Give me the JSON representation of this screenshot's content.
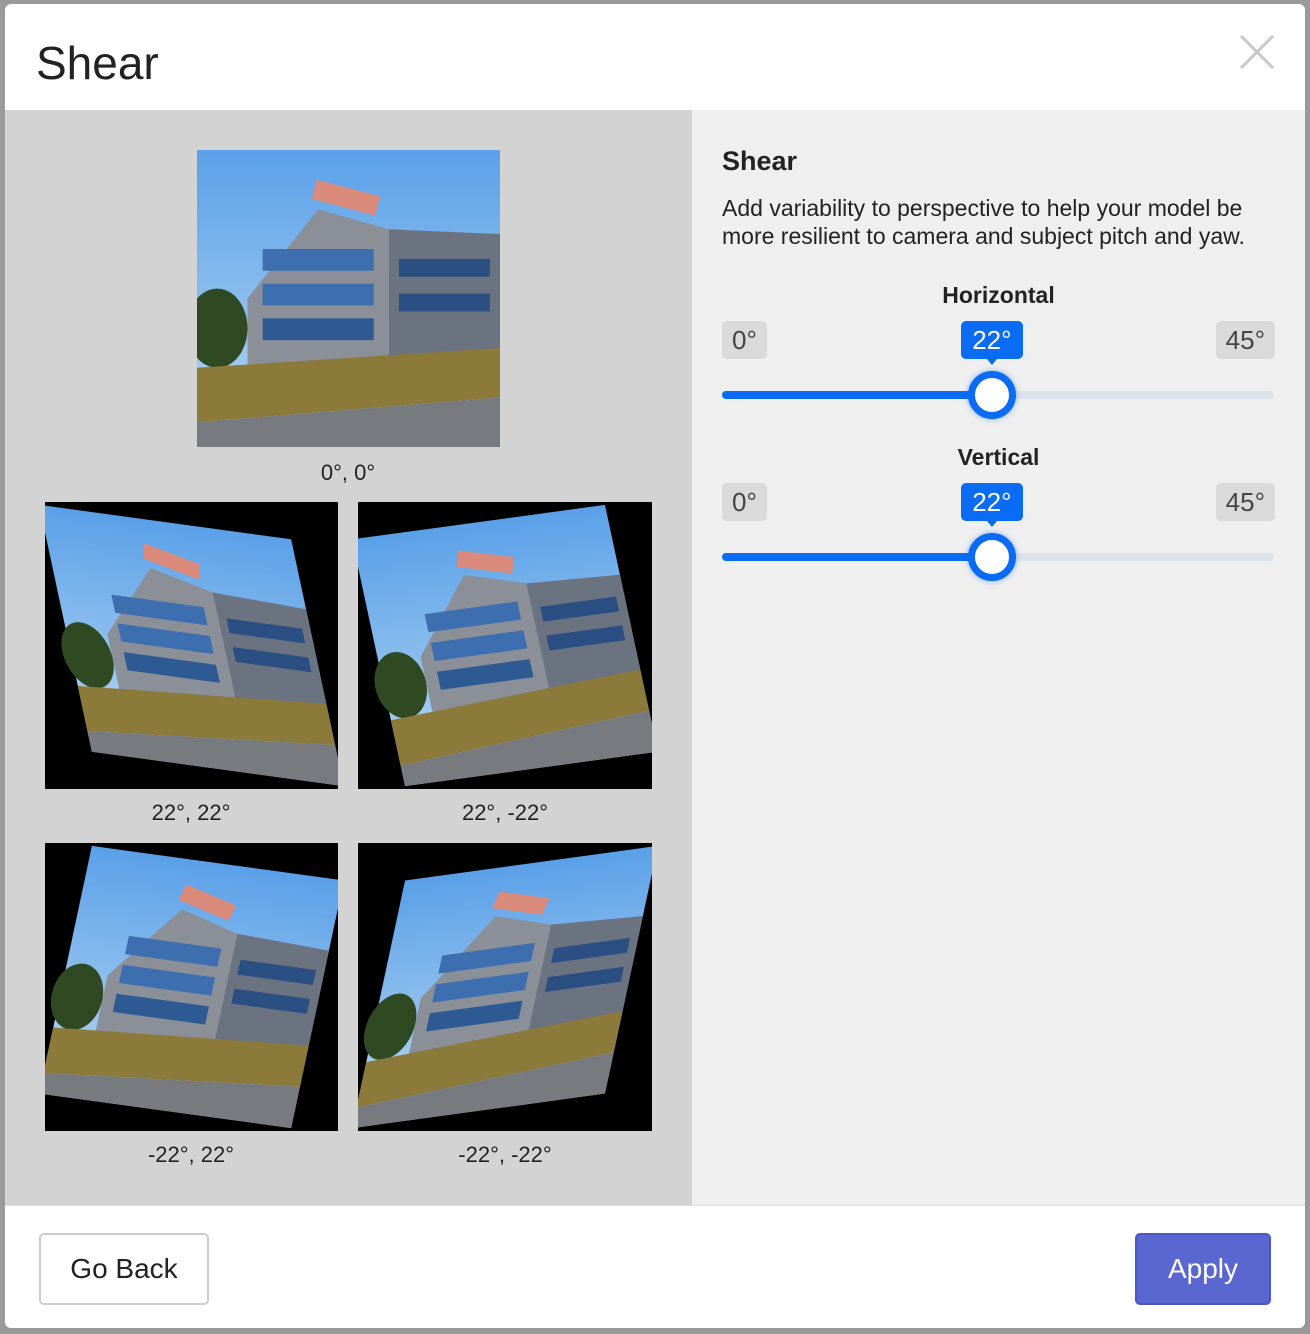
{
  "dialog": {
    "title": "Shear",
    "close_icon": "close-icon"
  },
  "preview": {
    "original_caption": "0°, 0°",
    "samples": [
      {
        "caption": "22°, 22°",
        "h": 22,
        "v": 22
      },
      {
        "caption": "22°, -22°",
        "h": 22,
        "v": -22
      },
      {
        "caption": "-22°, 22°",
        "h": -22,
        "v": 22
      },
      {
        "caption": "-22°, -22°",
        "h": -22,
        "v": -22
      }
    ]
  },
  "settings": {
    "title": "Shear",
    "description": "Add variability to perspective to help your model be more resilient to camera and subject pitch and yaw.",
    "horizontal": {
      "label": "Horizontal",
      "min": "0°",
      "max": "45°",
      "value_label": "22°",
      "value": 22,
      "range": [
        0,
        45
      ]
    },
    "vertical": {
      "label": "Vertical",
      "min": "0°",
      "max": "45°",
      "value_label": "22°",
      "value": 22,
      "range": [
        0,
        45
      ]
    }
  },
  "footer": {
    "back_label": "Go Back",
    "apply_label": "Apply"
  },
  "colors": {
    "accent": "#0a6cf5",
    "apply": "#5b67d0"
  }
}
